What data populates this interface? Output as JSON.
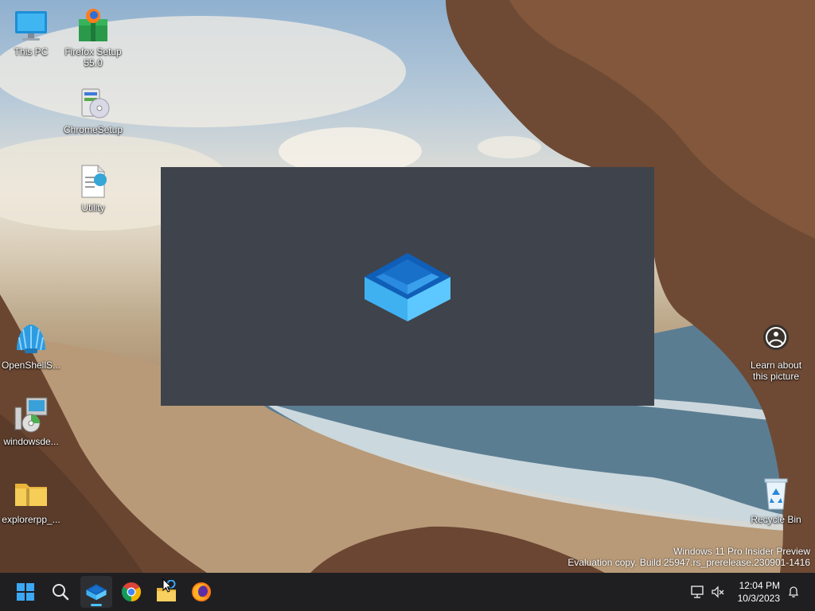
{
  "desktop": {
    "icons": [
      {
        "label": "This PC",
        "icon": "monitor-icon"
      },
      {
        "label": "Firefox Setup 55.0",
        "icon": "installer-box-icon"
      },
      {
        "label": "ChromeSetup",
        "icon": "setup-disc-icon"
      },
      {
        "label": "Utility",
        "icon": "document-icon"
      },
      {
        "label": "OpenShellS...",
        "icon": "shell-icon"
      },
      {
        "label": "windowsde...",
        "icon": "computer-disc-icon"
      },
      {
        "label": "explorerpp_...",
        "icon": "zip-folder-icon"
      },
      {
        "label": "Learn about this picture",
        "icon": "camera-info-icon"
      },
      {
        "label": "Recycle Bin",
        "icon": "recycle-bin-icon"
      }
    ]
  },
  "splash": {
    "icon": "app-box-logo-icon"
  },
  "watermark": {
    "line1": "Windows 11 Pro Insider Preview",
    "line2": "Evaluation copy. Build 25947.rs_prerelease.230901-1416"
  },
  "taskbar": {
    "apps": [
      {
        "name": "Start",
        "icon": "windows-logo-icon"
      },
      {
        "name": "Search",
        "icon": "search-icon"
      },
      {
        "name": "Dev Home",
        "icon": "app-box-logo-icon"
      },
      {
        "name": "Google Chrome",
        "icon": "chrome-icon"
      },
      {
        "name": "File Explorer",
        "icon": "folder-icon"
      },
      {
        "name": "Firefox",
        "icon": "firefox-icon"
      }
    ],
    "clock": {
      "time": "12:04 PM",
      "date": "10/3/2023"
    }
  },
  "colors": {
    "taskbar": "#1f1f22",
    "splash": "#3f434b",
    "accent": "#4cc2ff"
  }
}
